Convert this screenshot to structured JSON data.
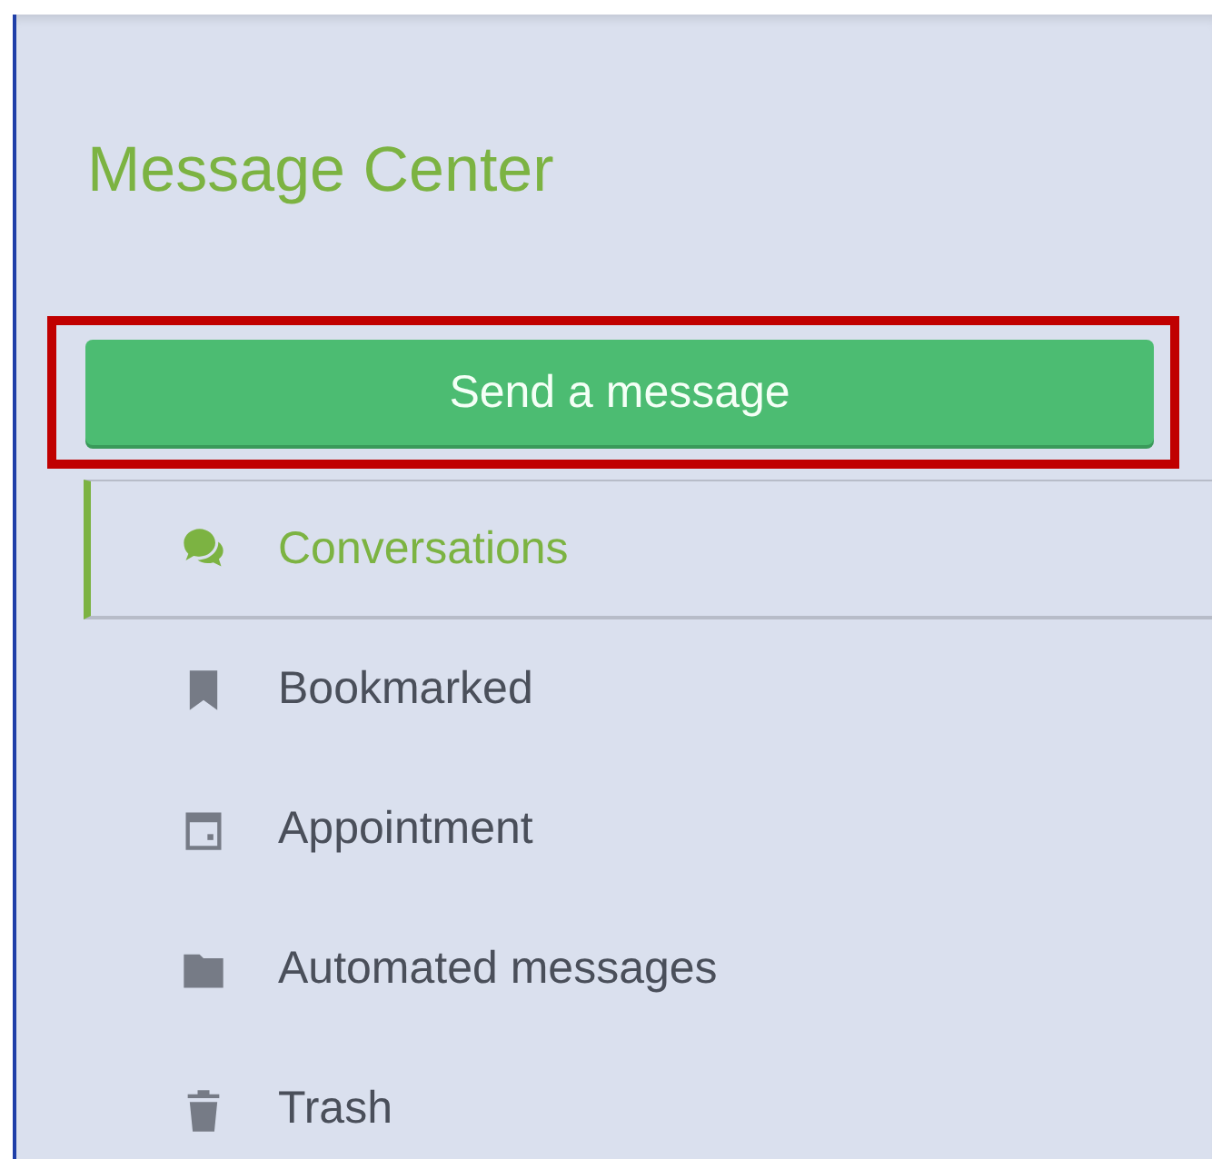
{
  "title": "Message Center",
  "send_button": {
    "label": "Send a message",
    "highlighted": true
  },
  "nav": [
    {
      "label": "Conversations",
      "kind": "chat",
      "selected": true
    },
    {
      "label": "Bookmarked",
      "kind": "bookmark",
      "selected": false
    },
    {
      "label": "Appointment",
      "kind": "calendar",
      "selected": false
    },
    {
      "label": "Automated messages",
      "kind": "folder",
      "selected": false
    },
    {
      "label": "Trash",
      "kind": "trash",
      "selected": false
    }
  ]
}
